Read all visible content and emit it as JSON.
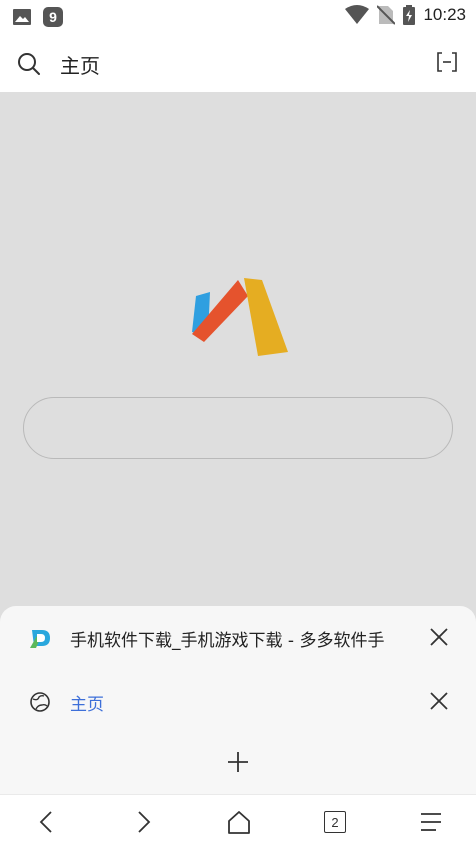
{
  "status_bar": {
    "time": "10:23",
    "icons": [
      "image-icon",
      "app-icon",
      "wifi-icon",
      "no-sim-icon",
      "battery-charging-icon"
    ]
  },
  "top_bar": {
    "title": "主页",
    "icons": [
      "search-icon",
      "expand-icon"
    ]
  },
  "home": {
    "logo": "via-browser-logo",
    "search_placeholder": ""
  },
  "tab_switcher": {
    "tabs": [
      {
        "title": "手机软件下载_手机游戏下载 - 多多软件手",
        "icon": "site-favicon",
        "active": false
      },
      {
        "title": "主页",
        "icon": "globe-icon",
        "active": true
      }
    ],
    "add_icon": "plus-icon"
  },
  "bottom_nav": {
    "tab_count": "2",
    "icons": [
      "back-icon",
      "forward-icon",
      "home-icon",
      "tabs-icon",
      "menu-icon"
    ]
  },
  "colors": {
    "active_tab_text": "#3d6fd9",
    "logo_blue": "#2f9fe0",
    "logo_red": "#e5532d",
    "logo_yellow": "#e5ad22"
  }
}
